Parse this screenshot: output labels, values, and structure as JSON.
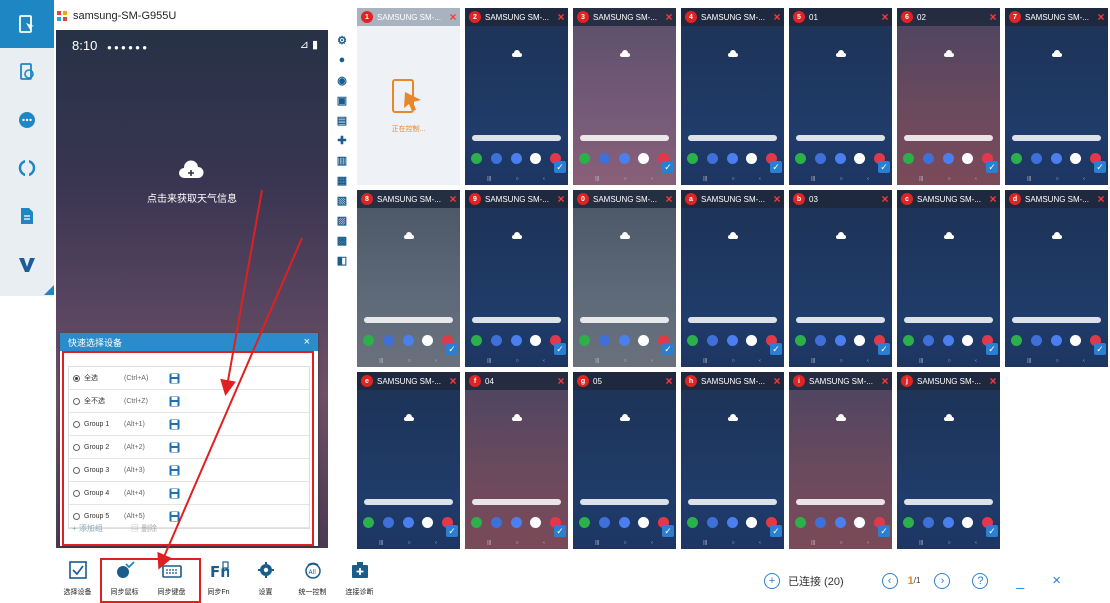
{
  "app": {
    "device_title": "samsung-SM-G955U"
  },
  "rail": {
    "items": [
      "device-list-icon",
      "device-group-icon",
      "chat-icon",
      "sync-icon",
      "file-icon",
      "v-logo-icon"
    ]
  },
  "phone": {
    "time": "8:10",
    "status_right": "⊿ ▮",
    "weather_text": "点击来获取天气信息"
  },
  "quick_select": {
    "title": "快速选择设备",
    "close": "×",
    "rows": [
      {
        "label": "全选",
        "shortcut": "(Ctrl+A)",
        "selected": true
      },
      {
        "label": "全不选",
        "shortcut": "(Ctrl+Z)",
        "selected": false
      },
      {
        "label": "Group 1",
        "shortcut": "(Alt+1)",
        "selected": false
      },
      {
        "label": "Group 2",
        "shortcut": "(Alt+2)",
        "selected": false
      },
      {
        "label": "Group 3",
        "shortcut": "(Alt+3)",
        "selected": false
      },
      {
        "label": "Group 4",
        "shortcut": "(Alt+4)",
        "selected": false
      },
      {
        "label": "Group 5",
        "shortcut": "(Alt+5)",
        "selected": false
      }
    ],
    "add_group": "+ 添加组",
    "delete": "删除"
  },
  "bottom_tools": [
    {
      "label": "选择设备",
      "icon": "select-device-icon"
    },
    {
      "label": "同步鼠标",
      "icon": "sync-mouse-icon"
    },
    {
      "label": "同步键盘",
      "icon": "sync-keyboard-icon"
    },
    {
      "label": "同步Fn",
      "icon": "sync-fn-icon"
    },
    {
      "label": "设置",
      "icon": "gear-icon"
    },
    {
      "label": "统一控制",
      "icon": "unified-control-icon"
    },
    {
      "label": "连接诊断",
      "icon": "diagnose-icon"
    }
  ],
  "tiles": [
    {
      "badge": "1",
      "name": "SAMSUNG SM-...",
      "style": "light",
      "controlling": true
    },
    {
      "badge": "2",
      "name": "SAMSUNG SM-...",
      "style": "blue"
    },
    {
      "badge": "3",
      "name": "SAMSUNG SM-...",
      "style": "pink"
    },
    {
      "badge": "4",
      "name": "SAMSUNG SM-...",
      "style": "blue"
    },
    {
      "badge": "5",
      "name": "01",
      "style": "blue"
    },
    {
      "badge": "6",
      "name": "02",
      "style": "wine"
    },
    {
      "badge": "7",
      "name": "SAMSUNG SM-...",
      "style": "blue"
    },
    {
      "badge": "8",
      "name": "SAMSUNG SM-...",
      "style": "gray"
    },
    {
      "badge": "9",
      "name": "SAMSUNG SM-...",
      "style": "blue"
    },
    {
      "badge": "0",
      "name": "SAMSUNG SM-...",
      "style": "gray"
    },
    {
      "badge": "a",
      "name": "SAMSUNG SM-...",
      "style": "blue"
    },
    {
      "badge": "b",
      "name": "03",
      "style": "blue"
    },
    {
      "badge": "c",
      "name": "SAMSUNG SM-...",
      "style": "blue"
    },
    {
      "badge": "d",
      "name": "SAMSUNG SM-...",
      "style": "blue"
    },
    {
      "badge": "e",
      "name": "SAMSUNG SM-...",
      "style": "blue"
    },
    {
      "badge": "f",
      "name": "04",
      "style": "wine"
    },
    {
      "badge": "g",
      "name": "05",
      "style": "blue"
    },
    {
      "badge": "h",
      "name": "SAMSUNG SM-...",
      "style": "blue"
    },
    {
      "badge": "i",
      "name": "SAMSUNG SM-...",
      "style": "wine"
    },
    {
      "badge": "j",
      "name": "SAMSUNG SM-...",
      "style": "blue"
    }
  ],
  "controlling_text": "正在控制...",
  "status": {
    "connected": "已连接 (20)",
    "page_current": "1",
    "page_total": "/1",
    "help": "?",
    "minimize": "_",
    "close": "×"
  },
  "colors": {
    "accent": "#1f86c4",
    "highlight": "#e02020",
    "badge": "#e02424"
  }
}
